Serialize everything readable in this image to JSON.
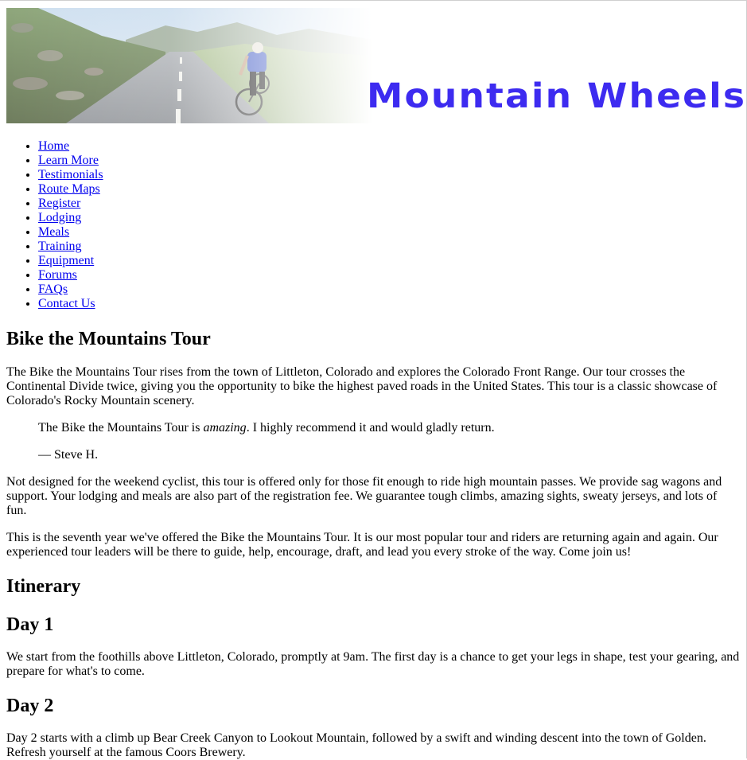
{
  "site": {
    "brand": "Mountain Wheels",
    "brand_color": "#3d2bf0",
    "banner_image": "cyclist-mountain-road-image"
  },
  "nav": {
    "items": [
      {
        "label": "Home"
      },
      {
        "label": "Learn More"
      },
      {
        "label": "Testimonials"
      },
      {
        "label": "Route Maps"
      },
      {
        "label": "Register"
      },
      {
        "label": "Lodging"
      },
      {
        "label": "Meals"
      },
      {
        "label": "Training"
      },
      {
        "label": "Equipment"
      },
      {
        "label": "Forums"
      },
      {
        "label": "FAQs"
      },
      {
        "label": "Contact Us"
      }
    ]
  },
  "main": {
    "title": "Bike the Mountains Tour",
    "intro": "The Bike the Mountains Tour rises from the town of Littleton, Colorado and explores the Colorado Front Range. Our tour crosses the Continental Divide twice, giving you the opportunity to bike the highest paved roads in the United States. This tour is a classic showcase of Colorado's Rocky Mountain scenery.",
    "quote": {
      "before": "The Bike the Mountains Tour is ",
      "emphasis": "amazing",
      "after": ". I highly recommend it and would gladly return.",
      "attribution": "— Steve H."
    },
    "para2": "Not designed for the weekend cyclist, this tour is offered only for those fit enough to ride high mountain passes. We provide sag wagons and support. Your lodging and meals are also part of the registration fee. We guarantee tough climbs, amazing sights, sweaty jerseys, and lots of fun.",
    "para3": "This is the seventh year we've offered the Bike the Mountains Tour. It is our most popular tour and riders are returning again and again. Our experienced tour leaders will be there to guide, help, encourage, draft, and lead you every stroke of the way. Come join us!",
    "itinerary_heading": "Itinerary",
    "days": [
      {
        "heading": "Day 1",
        "text": "We start from the foothills above Littleton, Colorado, promptly at 9am. The first day is a chance to get your legs in shape, test your gearing, and prepare for what's to come."
      },
      {
        "heading": "Day 2",
        "text": "Day 2 starts with a climb up Bear Creek Canyon to Lookout Mountain, followed by a swift and winding descent into the town of Golden. Refresh yourself at the famous Coors Brewery."
      }
    ]
  }
}
